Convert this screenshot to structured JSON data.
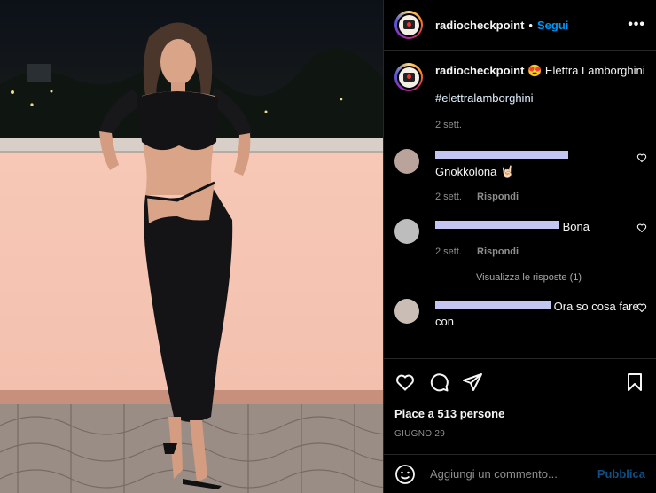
{
  "post": {
    "username": "radiocheckpoint",
    "separator": "•",
    "follow_label": "Segui",
    "more_label": "•••"
  },
  "caption": {
    "username": "radiocheckpoint",
    "emoji": "😍",
    "text": "Elettra Lamborghini",
    "hashtag": "#elettralamborghini",
    "time": "2 sett."
  },
  "comments": [
    {
      "text": "Gnokkolona 🤘🏻",
      "time": "2 sett.",
      "reply": "Rispondi"
    },
    {
      "text": "Bona",
      "time": "2 sett.",
      "reply": "Rispondi",
      "view_replies": "Visualizza le risposte (1)"
    },
    {
      "text": "Ora so cosa fare con"
    }
  ],
  "actions": {
    "likes": "Piace a 513 persone",
    "date": "GIUGNO 29"
  },
  "add_comment": {
    "placeholder": "Aggiungi un commento...",
    "publish": "Pubblica"
  },
  "colors": {
    "accent": "#0095f6",
    "background": "#000000",
    "muted": "#8e8e8e"
  }
}
